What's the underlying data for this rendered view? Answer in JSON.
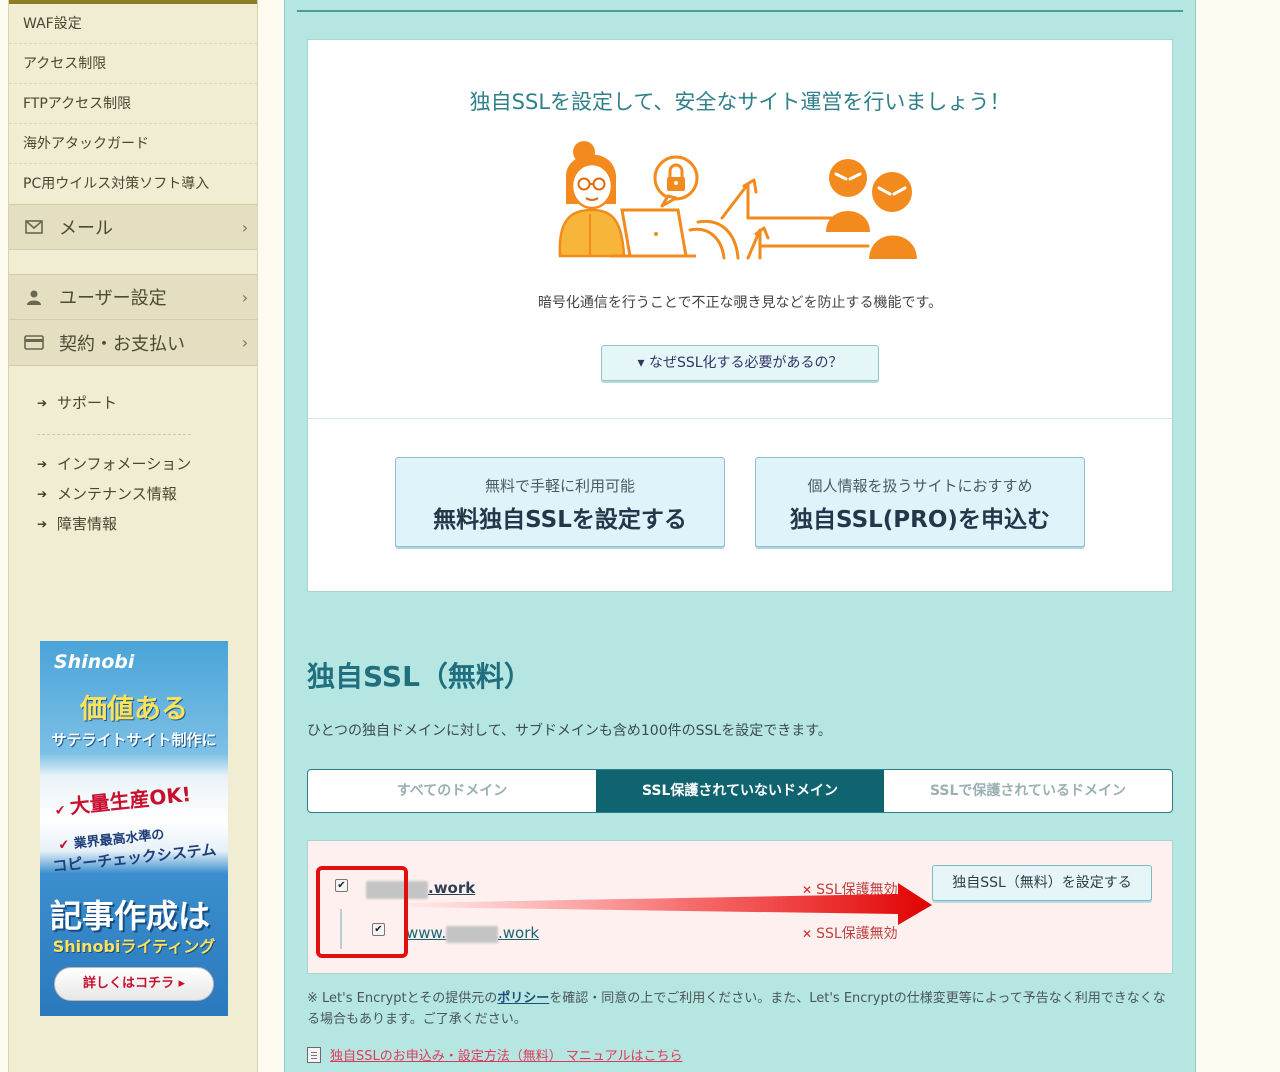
{
  "sidebar": {
    "security_items": [
      "WAF設定",
      "アクセス制限",
      "FTPアクセス制限",
      "海外アタックガード",
      "PC用ウイルス対策ソフト導入"
    ],
    "categories": {
      "mail": "メール",
      "user": "ユーザー設定",
      "contract": "契約・お支払い"
    },
    "links": {
      "support": "サポート",
      "info": "インフォメーション",
      "maintenance": "メンテナンス情報",
      "failure": "障害情報"
    }
  },
  "banner": {
    "logo": "Shinobi",
    "head1": "価値ある",
    "head2": "サテライトサイト制作に",
    "point1": "大量生産OK!",
    "point2a": "業界最高水準の",
    "point2b": "コピーチェックシステム",
    "big": "記事作成は",
    "brand": "Shinobiライティング",
    "cta": "詳しくはコチラ ▸"
  },
  "promo": {
    "title": "独自SSLを設定して、安全なサイト運営を行いましょう！",
    "description": "暗号化通信を行うことで不正な覗き見などを防止する機能です。",
    "why_label": "▾ なぜSSL化する必要があるの？",
    "free_small": "無料で手軽に利用可能",
    "free_big": "無料独自SSLを設定する",
    "pro_small": "個人情報を扱うサイトにおすすめ",
    "pro_big": "独自SSL(PRO)を申込む"
  },
  "section": {
    "title": "独自SSL（無料）",
    "description": "ひとつの独自ドメインに対して、サブドメインも含め100件のSSLを設定できます。"
  },
  "tabs": [
    {
      "label": "すべてのドメイン",
      "active": false
    },
    {
      "label": "SSL保護されていないドメイン",
      "active": true
    },
    {
      "label": "SSLで保護されているドメイン",
      "active": false
    }
  ],
  "domains": {
    "root_suffix": ".work",
    "sub_prefix": "www.",
    "sub_suffix": ".work",
    "status_root": "SSL保護無効",
    "status_sub": "SSL保護無効",
    "set_button": "独自SSL（無料）を設定する"
  },
  "note": {
    "prefix": "※ Let's Encryptとその提供元の",
    "policy": "ポリシー",
    "suffix": "を確認・同意の上でご利用ください。また、Let's Encryptの仕様変更等によって予告なく利用できなくなる場合もあります。ご了承ください。"
  },
  "manual_link": "独自SSLのお申込み・設定方法（無料） マニュアルはこちら",
  "colors": {
    "main_bg": "#b6e6e2",
    "active_tab": "#0f6470",
    "sidebar_bg": "#f1edd3",
    "accent_orange": "#f28a1e",
    "highlight_red": "#e01010"
  }
}
